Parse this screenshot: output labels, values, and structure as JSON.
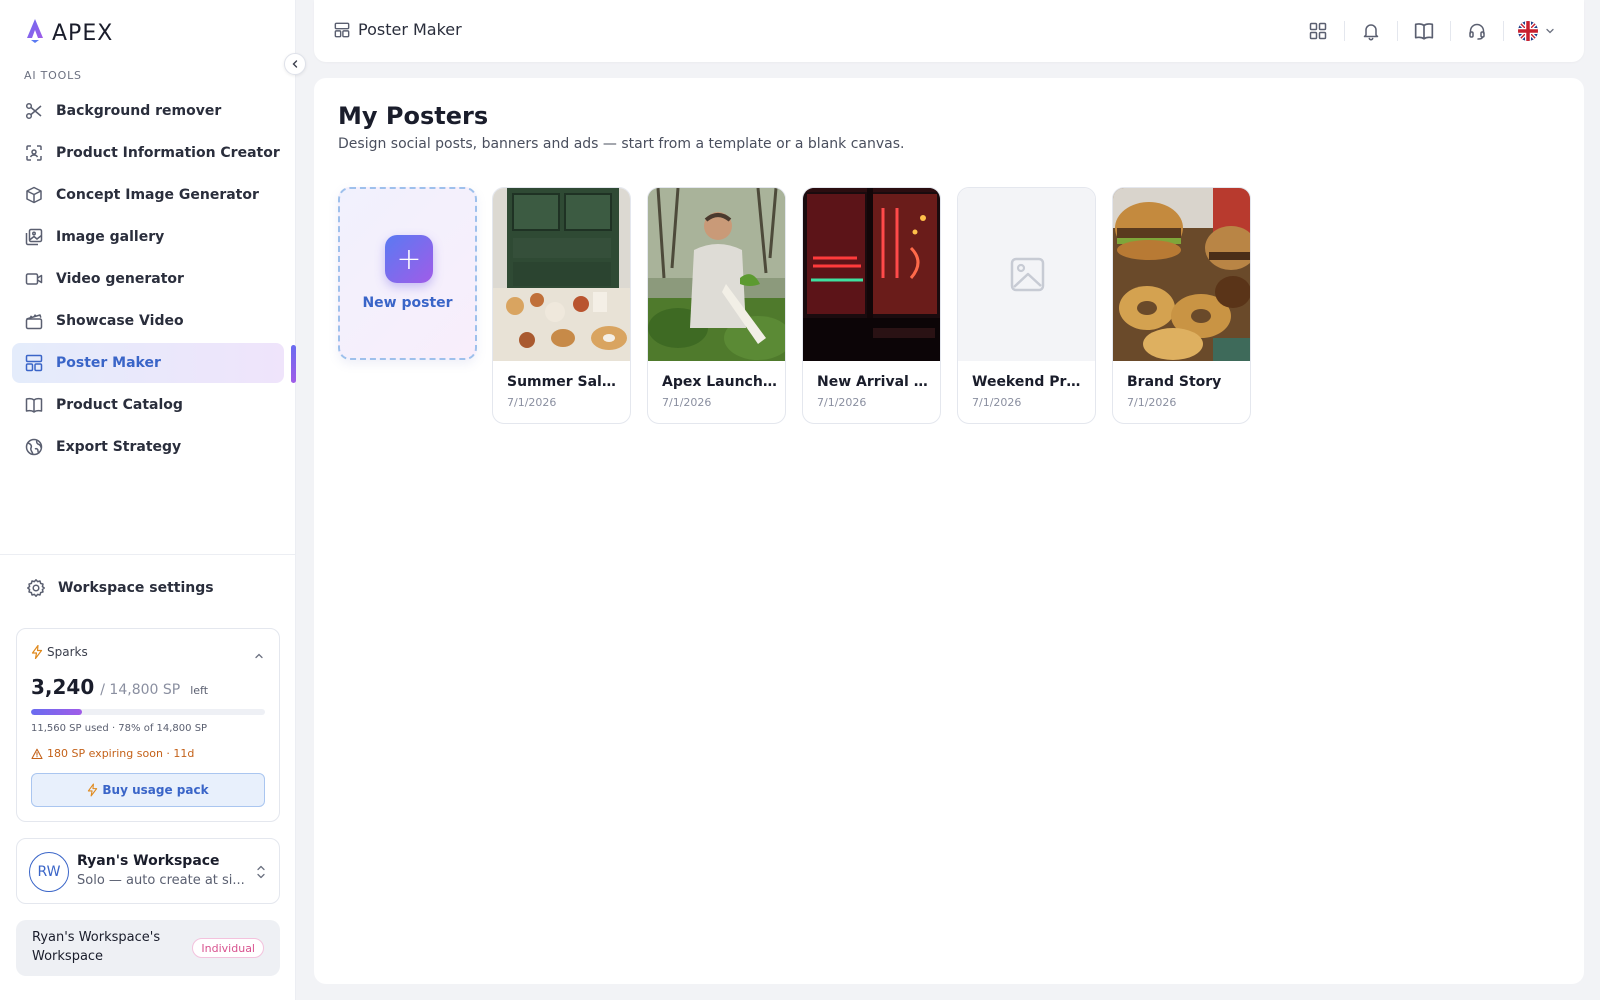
{
  "app": {
    "name": "APEX"
  },
  "sidebar": {
    "section_label": "AI TOOLS",
    "items": [
      {
        "label": "Background remover",
        "icon": "scissors-icon"
      },
      {
        "label": "Product Information Creator",
        "icon": "scan-icon"
      },
      {
        "label": "Concept Image Generator",
        "icon": "cube-icon"
      },
      {
        "label": "Image gallery",
        "icon": "gallery-icon"
      },
      {
        "label": "Video generator",
        "icon": "video-icon"
      },
      {
        "label": "Showcase Video",
        "icon": "clapper-icon"
      },
      {
        "label": "Poster Maker",
        "icon": "layout-icon",
        "active": true
      },
      {
        "label": "Product Catalog",
        "icon": "book-icon"
      },
      {
        "label": "Export Strategy",
        "icon": "globe-icon"
      }
    ],
    "workspace_settings": "Workspace settings",
    "sparks": {
      "label": "Sparks",
      "amount": "3,240",
      "total": "/ 14,800 SP",
      "left_label": "left",
      "progress_fraction": 0.22,
      "used_text": "11,560 SP used · 78% of 14,800 SP",
      "expiring_text": "180 SP expiring soon · 11d",
      "buy_label": "Buy usage pack"
    },
    "workspace": {
      "initials": "RW",
      "name": "Ryan's Workspace",
      "subtitle": "Solo — auto create at si..."
    },
    "plan": {
      "name": "Ryan's Workspace's Workspace",
      "badge": "Individual"
    }
  },
  "topbar": {
    "title": "Poster Maker",
    "language": "en-GB"
  },
  "main": {
    "title": "My Posters",
    "subtitle": "Design social posts, banners and ads — start from a template or a blank canvas.",
    "new_poster_label": "New poster",
    "posters": [
      {
        "title": "Summer Sale P...",
        "date": "7/1/2026",
        "thumb": "bakery-shelf"
      },
      {
        "title": "Apex Launch P...",
        "date": "7/1/2026",
        "thumb": "farmer-vegetables"
      },
      {
        "title": "New Arrival Ba...",
        "date": "7/1/2026",
        "thumb": "neon-restaurant"
      },
      {
        "title": "Weekend Pro...",
        "date": "7/1/2026",
        "thumb": "placeholder"
      },
      {
        "title": "Brand Story",
        "date": "7/1/2026",
        "thumb": "food-platter"
      }
    ]
  },
  "colors": {
    "accent": "#3a65c8",
    "gradient_start": "#6a6cf0",
    "gradient_end": "#a05ce8",
    "warning": "#c4621a"
  }
}
